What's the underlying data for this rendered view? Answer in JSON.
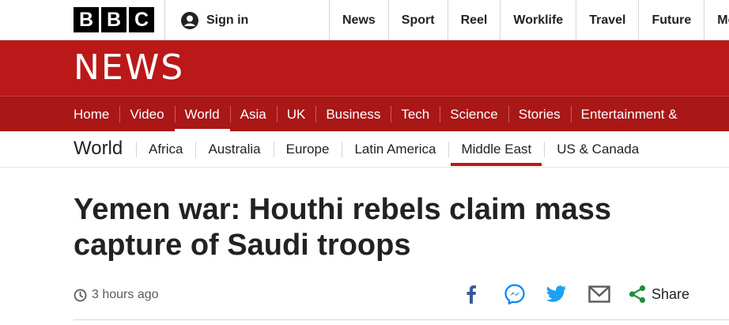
{
  "brand": {
    "bbc_letters": [
      "B",
      "B",
      "C"
    ],
    "news_logo": "NEWS"
  },
  "account": {
    "signin_label": "Sign in"
  },
  "global_nav": [
    "News",
    "Sport",
    "Reel",
    "Worklife",
    "Travel",
    "Future",
    "Mo"
  ],
  "section_nav": {
    "items": [
      "Home",
      "Video",
      "World",
      "Asia",
      "UK",
      "Business",
      "Tech",
      "Science",
      "Stories",
      "Entertainment &"
    ],
    "active": "World"
  },
  "sub_nav": {
    "title": "World",
    "items": [
      "Africa",
      "Australia",
      "Europe",
      "Latin America",
      "Middle East",
      "US & Canada"
    ],
    "active": "Middle East"
  },
  "article": {
    "headline": "Yemen war: Houthi rebels claim mass capture of Saudi troops",
    "timestamp": "3 hours ago"
  },
  "share": {
    "label": "Share"
  },
  "colors": {
    "brand_red": "#bb1919",
    "nav_red": "#a91717",
    "facebook": "#3b5998",
    "messenger": "#0084ff",
    "twitter": "#1da1f2",
    "share_green": "#1c8f38"
  },
  "icons": [
    "user-icon",
    "clock-icon",
    "facebook-icon",
    "messenger-icon",
    "twitter-icon",
    "email-icon",
    "share-icon"
  ]
}
